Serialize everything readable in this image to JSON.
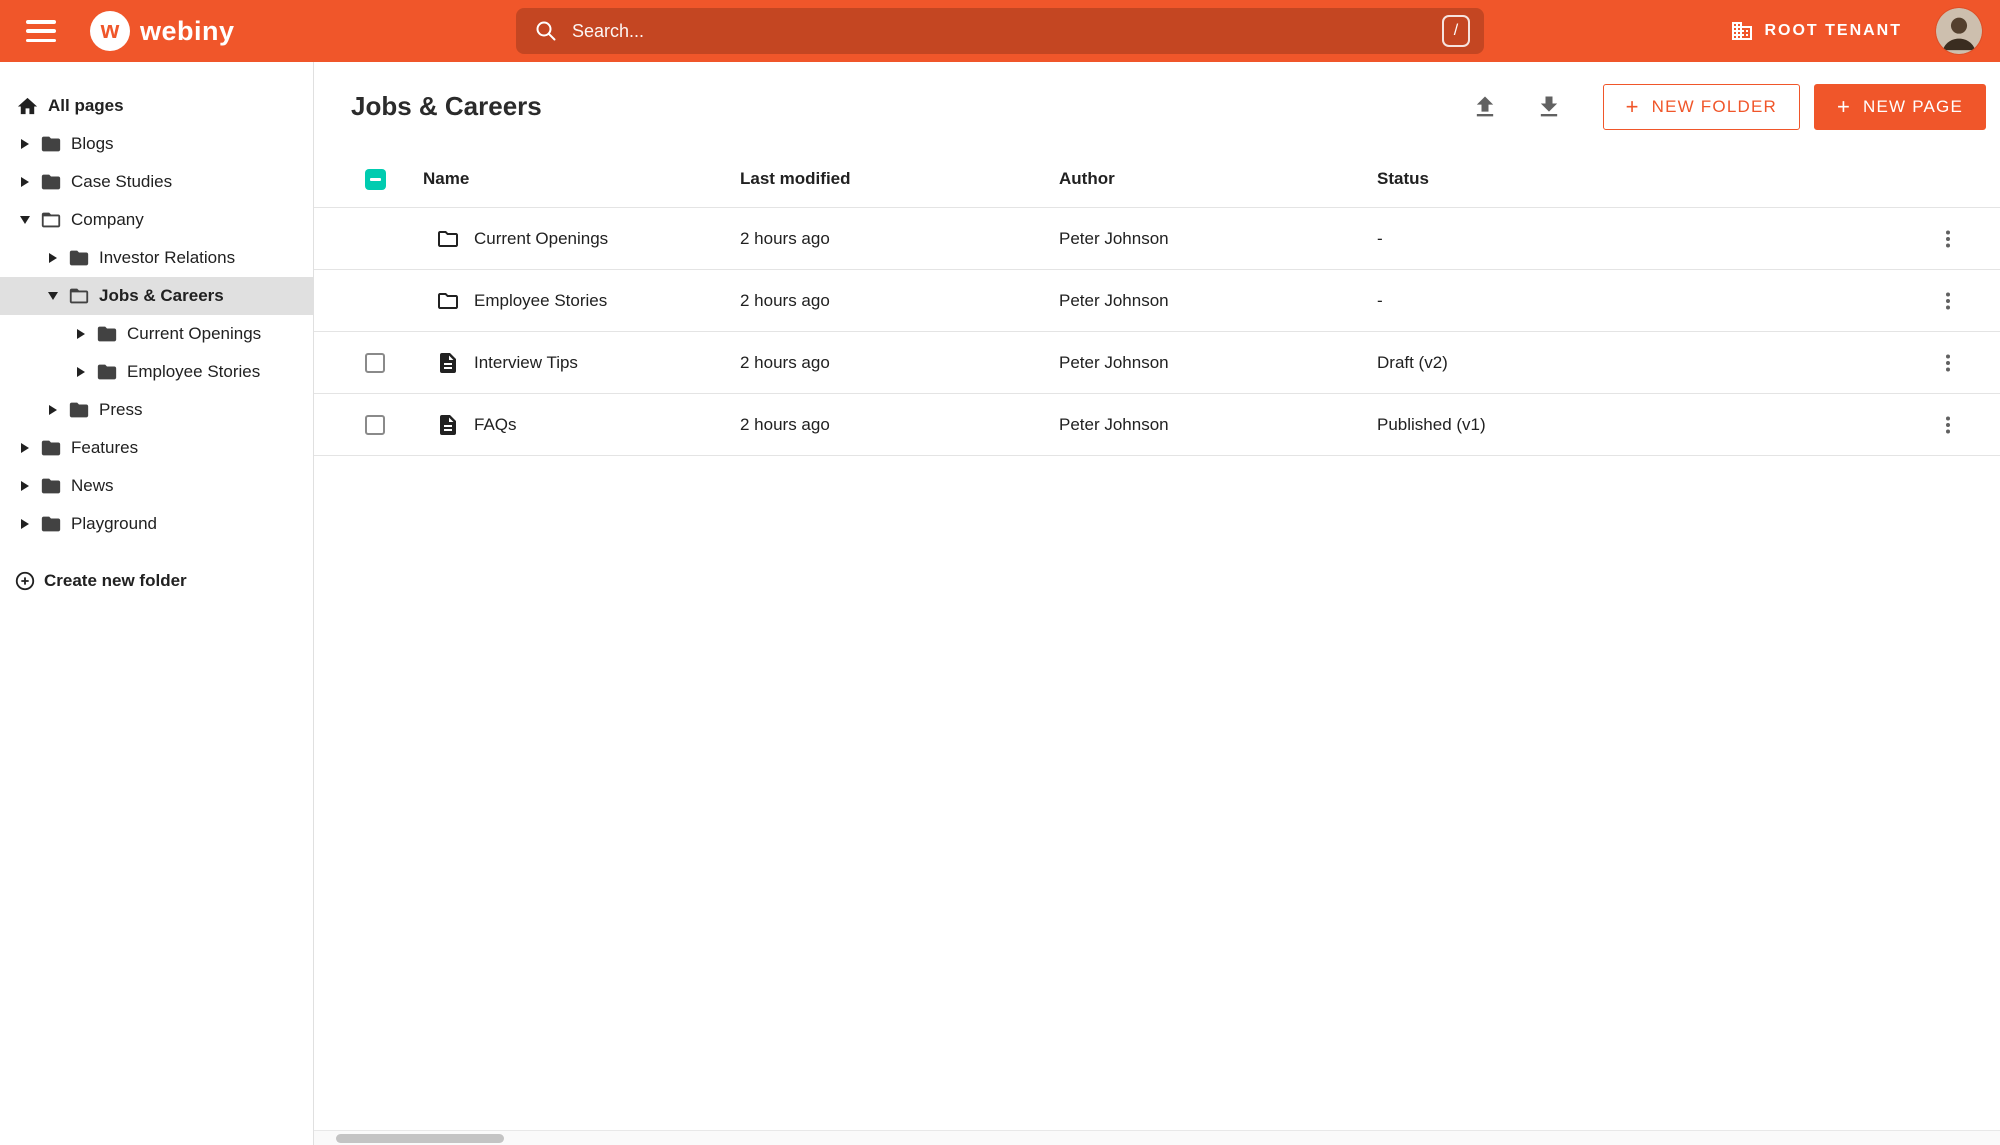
{
  "topbar": {
    "brand_initial": "w",
    "brand": "webiny",
    "search_placeholder": "Search...",
    "search_shortcut": "/",
    "tenant_label": "ROOT TENANT"
  },
  "sidebar": {
    "all_pages_label": "All pages",
    "tree": [
      {
        "label": "Blogs"
      },
      {
        "label": "Case Studies"
      },
      {
        "label": "Company"
      },
      {
        "label": "Investor Relations"
      },
      {
        "label": "Jobs & Careers"
      },
      {
        "label": "Current Openings"
      },
      {
        "label": "Employee Stories"
      },
      {
        "label": "Press"
      },
      {
        "label": "Features"
      },
      {
        "label": "News"
      },
      {
        "label": "Playground"
      }
    ],
    "create_folder_label": "Create new folder"
  },
  "main": {
    "title": "Jobs & Careers",
    "new_folder_button": "NEW FOLDER",
    "new_page_button": "NEW PAGE",
    "table": {
      "headers": {
        "name": "Name",
        "modified": "Last modified",
        "author": "Author",
        "status": "Status"
      },
      "rows": [
        {
          "name": "Current Openings",
          "modified": "2 hours ago",
          "author": "Peter Johnson",
          "status": "-"
        },
        {
          "name": "Employee Stories",
          "modified": "2 hours ago",
          "author": "Peter Johnson",
          "status": "-"
        },
        {
          "name": "Interview Tips",
          "modified": "2 hours ago",
          "author": "Peter Johnson",
          "status": "Draft (v2)"
        },
        {
          "name": "FAQs",
          "modified": "2 hours ago",
          "author": "Peter Johnson",
          "status": "Published (v1)"
        }
      ]
    }
  },
  "colors": {
    "brand_orange": "#f0562a",
    "accent_teal": "#00ccb0"
  }
}
